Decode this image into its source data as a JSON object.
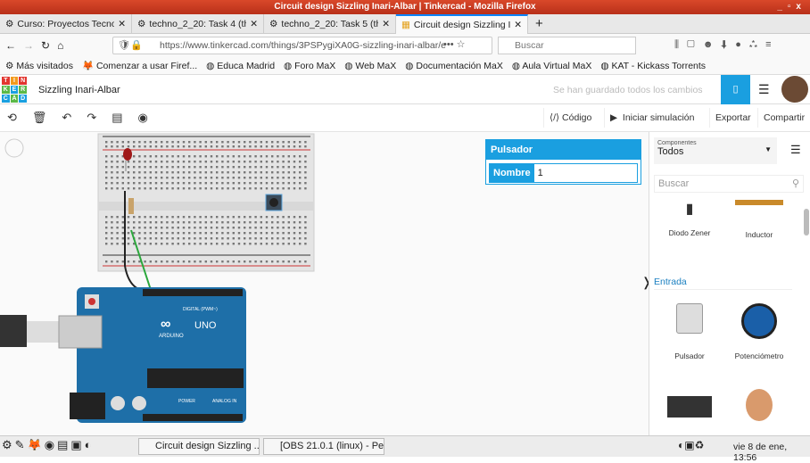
{
  "window": {
    "title": "Circuit design Sizzling Inari-Albar | Tinkercad - Mozilla Firefox"
  },
  "tabs": [
    {
      "label": "Curso: Proyectos Tecnol"
    },
    {
      "label": "techno_2_20: Task 4 (th"
    },
    {
      "label": "techno_2_20: Task 5 (th"
    },
    {
      "label": "Circuit design Sizzling In"
    }
  ],
  "nav": {
    "url": "https://www.tinkercad.com/things/3PSPygiXA0G-sizzling-inari-albar/e",
    "search_placeholder": "Buscar"
  },
  "bookmarks": [
    "Más visitados",
    "Comenzar a usar Firef...",
    "Educa Madrid",
    "Foro MaX",
    "Web MaX",
    "Documentación MaX",
    "Aula Virtual MaX",
    "KAT - Kickass Torrents"
  ],
  "app": {
    "logo": [
      "TIN",
      "KER",
      "CAD"
    ],
    "project_name": "Sizzling Inari-Albar",
    "save_status": "Se han guardado todos los cambios"
  },
  "toolbar": {
    "code": "Código",
    "simulate": "Iniciar simulación",
    "export": "Exportar",
    "share": "Compartir"
  },
  "inspector": {
    "title": "Pulsador",
    "name_label": "Nombre",
    "name_value": "1"
  },
  "components": {
    "filter_label": "Componentes",
    "filter_value": "Todos",
    "search_placeholder": "Buscar",
    "top_items": [
      "Diodo Zener",
      "Inductor"
    ],
    "section": "Entrada",
    "items": [
      "Pulsador",
      "Potenciómetro"
    ]
  },
  "board": {
    "brand": "ARDUINO",
    "model": "UNO",
    "digital": "DIGITAL (PWM~)",
    "power": "POWER",
    "analog": "ANALOG IN"
  },
  "taskbar": {
    "tasks": [
      "Circuit design Sizzling ...",
      "[OBS 21.0.1 (linux) - Pe..."
    ],
    "clock": "vie 8 de ene, 13:56"
  }
}
